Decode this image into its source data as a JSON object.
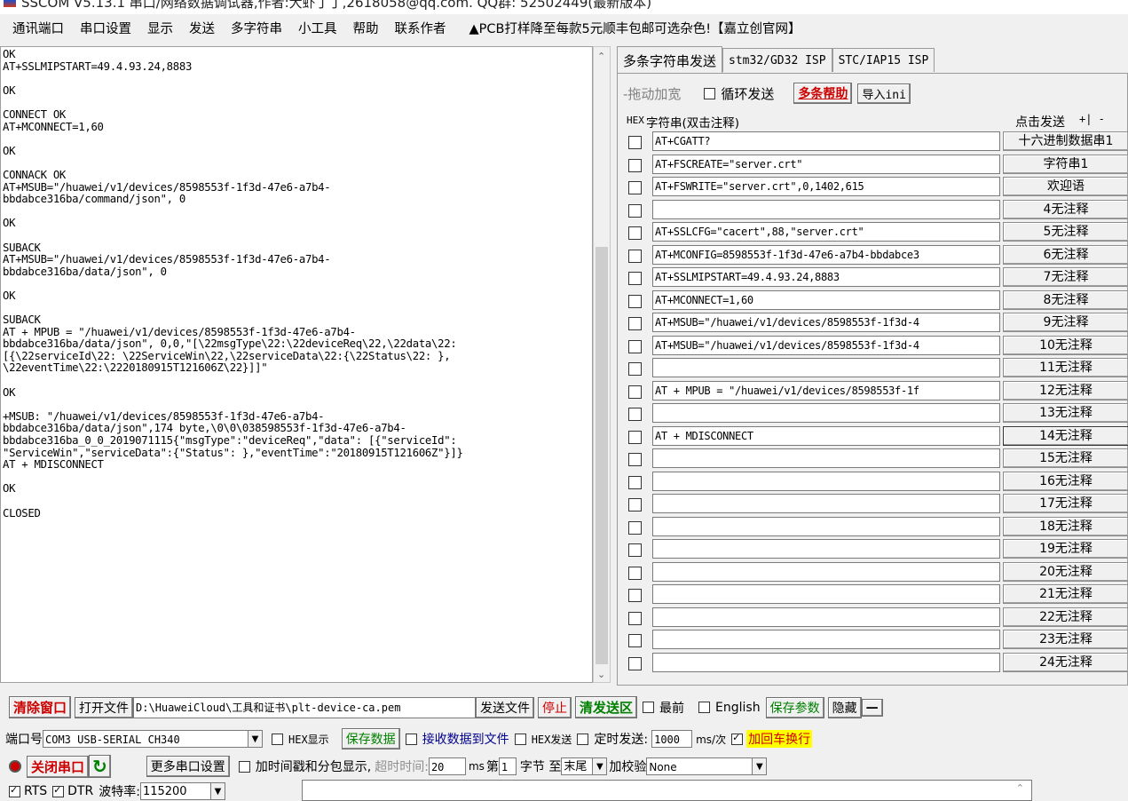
{
  "title": "SSCOM V5.13.1 串口/网络数据调试器,作者:大虾丁丁,2618058@qq.com. QQ群: 52502449(最新版本)",
  "menu": [
    "通讯端口",
    "串口设置",
    "显示",
    "发送",
    "多字符串",
    "小工具",
    "帮助",
    "联系作者",
    "▲PCB打样降至每款5元顺丰包邮可选杂色!【嘉立创官网】"
  ],
  "receive_log": "OK\nAT+SSLMIPSTART=49.4.93.24,8883\n\nOK\n\nCONNECT OK\nAT+MCONNECT=1,60\n\nOK\n\nCONNACK OK\nAT+MSUB=\"/huawei/v1/devices/8598553f-1f3d-47e6-a7b4-\nbbdabce316ba/command/json\", 0\n\nOK\n\nSUBACK\nAT+MSUB=\"/huawei/v1/devices/8598553f-1f3d-47e6-a7b4-\nbbdabce316ba/data/json\", 0\n\nOK\n\nSUBACK\nAT + MPUB = \"/huawei/v1/devices/8598553f-1f3d-47e6-a7b4-\nbbdabce316ba/data/json\", 0,0,\"[\\22msgType\\22:\\22deviceReq\\22,\\22data\\22:\n[{\\22serviceId\\22: \\22ServiceWin\\22,\\22serviceData\\22:{\\22Status\\22: },\n\\22eventTime\\22:\\2220180915T121606Z\\22}]]\"\n\nOK\n\n+MSUB: \"/huawei/v1/devices/8598553f-1f3d-47e6-a7b4-\nbbdabce316ba/data/json\",174 byte,\\0\\0\\038598553f-1f3d-47e6-a7b4-\nbbdabce316ba_0_0_2019071115{\"msgType\":\"deviceReq\",\"data\": [{\"serviceId\":\n\"ServiceWin\",\"serviceData\":{\"Status\": },\"eventTime\":\"20180915T121606Z\"}]}\nAT + MDISCONNECT\n\nOK\n\nCLOSED",
  "tabs": [
    "多条字符串发送",
    "stm32/GD32 ISP",
    "STC/IAP15 ISP"
  ],
  "multi": {
    "drag_label": "-拖动加宽",
    "loop_label": "循环发送",
    "help_label": "多条帮助",
    "import_label": "导入ini",
    "hex_label": "HEX",
    "string_label": "字符串(双击注释)",
    "click_send_label": "点击发送",
    "plus_minus": "+| -",
    "rows": [
      {
        "cmd": "AT+CGATT?",
        "label": "十六进制数据串1"
      },
      {
        "cmd": "AT+FSCREATE=\"server.crt\"",
        "label": "字符串1"
      },
      {
        "cmd": "AT+FSWRITE=\"server.crt\",0,1402,615",
        "label": "欢迎语"
      },
      {
        "cmd": "",
        "label": "4无注释"
      },
      {
        "cmd": "AT+SSLCFG=\"cacert\",88,\"server.crt\"",
        "label": "5无注释"
      },
      {
        "cmd": "AT+MCONFIG=8598553f-1f3d-47e6-a7b4-bbdabce3",
        "label": "6无注释"
      },
      {
        "cmd": "AT+SSLMIPSTART=49.4.93.24,8883",
        "label": "7无注释"
      },
      {
        "cmd": "AT+MCONNECT=1,60",
        "label": "8无注释"
      },
      {
        "cmd": "AT+MSUB=\"/huawei/v1/devices/8598553f-1f3d-4",
        "label": "9无注释"
      },
      {
        "cmd": "AT+MSUB=\"/huawei/v1/devices/8598553f-1f3d-4",
        "label": "10无注释"
      },
      {
        "cmd": "",
        "label": "11无注释"
      },
      {
        "cmd": "AT + MPUB = \"/huawei/v1/devices/8598553f-1f",
        "label": "12无注释"
      },
      {
        "cmd": "",
        "label": "13无注释"
      },
      {
        "cmd": "AT + MDISCONNECT",
        "label": "14无注释"
      },
      {
        "cmd": "",
        "label": "15无注释"
      },
      {
        "cmd": "",
        "label": "16无注释"
      },
      {
        "cmd": "",
        "label": "17无注释"
      },
      {
        "cmd": "",
        "label": "18无注释"
      },
      {
        "cmd": "",
        "label": "19无注释"
      },
      {
        "cmd": "",
        "label": "20无注释"
      },
      {
        "cmd": "",
        "label": "21无注释"
      },
      {
        "cmd": "",
        "label": "22无注释"
      },
      {
        "cmd": "",
        "label": "23无注释"
      },
      {
        "cmd": "",
        "label": "24无注释"
      }
    ]
  },
  "bottom": {
    "clear_window": "清除窗口",
    "open_file": "打开文件",
    "file_path": "D:\\HuaweiCloud\\工具和证书\\plt-device-ca.pem",
    "send_file": "发送文件",
    "stop": "停止",
    "clear_send": "清发送区",
    "topmost": "最前",
    "english": "English",
    "save_params": "保存参数",
    "hide": "隐藏",
    "dash": "—",
    "port_label": "端口号",
    "port_value": "COM3 USB-SERIAL CH340",
    "hex_display": "HEX显示",
    "save_data": "保存数据",
    "recv_to_file": "接收数据到文件",
    "hex_send": "HEX发送",
    "timed_send": "定时发送:",
    "interval": "1000",
    "interval_unit": "ms/次",
    "append_crlf": "加回车换行",
    "close_port": "关闭串口",
    "more_settings": "更多串口设置",
    "timestamp_label": "加时间戳和分包显示,",
    "timeout_label": "超时时间:",
    "timeout_value": "20",
    "ms": "ms",
    "byte_prefix": "第",
    "byte_index": "1",
    "byte_mid": "字节 至",
    "byte_end": "末尾",
    "checksum_label": "加校验",
    "checksum_value": "None",
    "rts": "RTS",
    "dtr": "DTR",
    "baud_label": "波特率:",
    "baud_value": "115200"
  }
}
